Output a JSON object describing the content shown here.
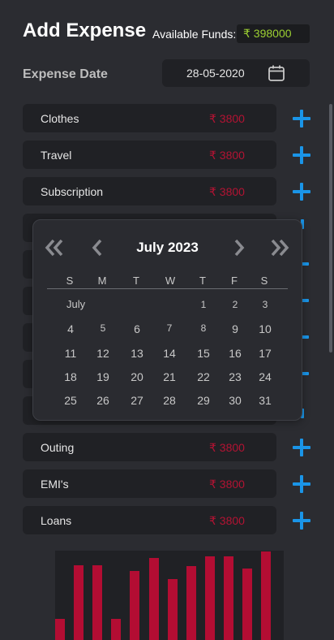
{
  "header": {
    "title": "Add Expense",
    "funds_label": "Available Funds:",
    "funds_value": "₹ 398000"
  },
  "date": {
    "label": "Expense Date",
    "value": "28-05-2020",
    "icon": "calendar-icon"
  },
  "expenses": [
    {
      "label": "Clothes",
      "amount": "₹ 3800"
    },
    {
      "label": "Travel",
      "amount": "₹ 3800"
    },
    {
      "label": "Subscription",
      "amount": "₹ 3800"
    },
    {
      "label": "Outing",
      "amount": "₹ 3800"
    },
    {
      "label": "EMI's",
      "amount": "₹ 3800"
    },
    {
      "label": "Loans",
      "amount": "₹ 3800"
    }
  ],
  "calendar": {
    "title": "July 2023",
    "weekdays": [
      "S",
      "M",
      "T",
      "W",
      "T",
      "F",
      "S"
    ],
    "month_label": "July",
    "first_row": [
      "1",
      "2",
      "3"
    ],
    "weeks": [
      [
        "4",
        "5",
        "6",
        "7",
        "8",
        "9",
        "10"
      ],
      [
        "11",
        "12",
        "13",
        "14",
        "15",
        "16",
        "17"
      ],
      [
        "18",
        "19",
        "20",
        "21",
        "22",
        "23",
        "24"
      ],
      [
        "25",
        "26",
        "27",
        "28",
        "29",
        "30",
        "31"
      ]
    ]
  },
  "chart_data": {
    "type": "bar",
    "values": [
      26,
      92,
      92,
      26,
      85,
      101,
      75,
      91,
      103,
      103,
      88,
      109
    ],
    "ylim": [
      0,
      110
    ]
  },
  "colors": {
    "background": "#2b2c31",
    "row_background": "#202125",
    "accent": "#1a95e8",
    "amount": "#b31333",
    "funds": "#9ccf32",
    "bar": "#b30d33"
  }
}
